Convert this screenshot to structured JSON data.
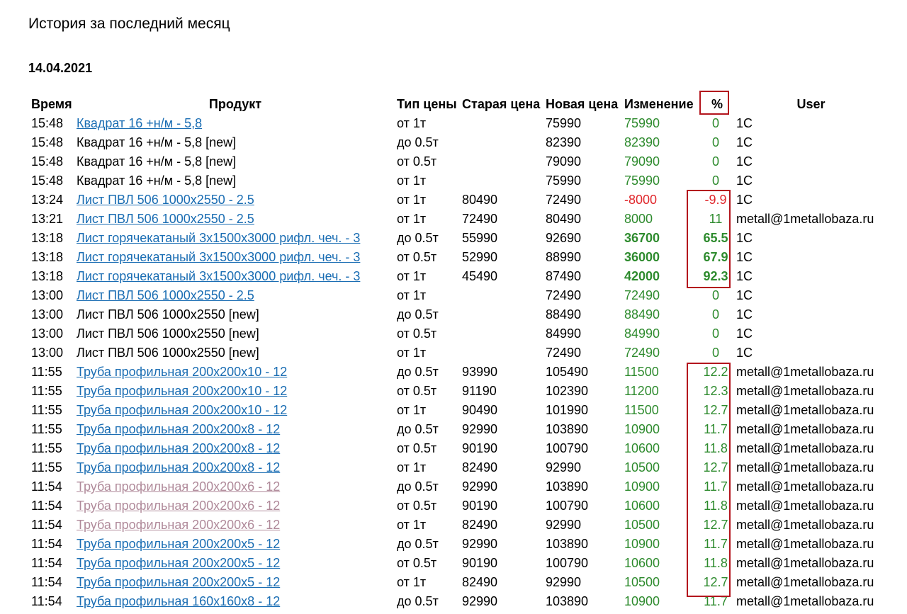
{
  "page": {
    "title": "История за последний месяц",
    "date": "14.04.2021"
  },
  "table": {
    "headers": {
      "time": "Время",
      "product": "Продукт",
      "price_type": "Тип цены",
      "old_price": "Старая цена",
      "new_price": "Новая цена",
      "change": "Изменение",
      "percent": "%",
      "user": "User"
    },
    "rows": [
      {
        "time": "15:48",
        "product": "Квадрат 16 +н/м - 5,8",
        "link": true,
        "visited": false,
        "price_type": "от 1т",
        "old_price": "",
        "new_price": "75990",
        "change": "75990",
        "change_color": "pos",
        "bold": false,
        "percent": "0",
        "pct_color": "pos",
        "user": "1С"
      },
      {
        "time": "15:48",
        "product": "Квадрат 16 +н/м - 5,8 [new]",
        "link": false,
        "visited": false,
        "price_type": "до 0.5т",
        "old_price": "",
        "new_price": "82390",
        "change": "82390",
        "change_color": "pos",
        "bold": false,
        "percent": "0",
        "pct_color": "pos",
        "user": "1С"
      },
      {
        "time": "15:48",
        "product": "Квадрат 16 +н/м - 5,8 [new]",
        "link": false,
        "visited": false,
        "price_type": "от 0.5т",
        "old_price": "",
        "new_price": "79090",
        "change": "79090",
        "change_color": "pos",
        "bold": false,
        "percent": "0",
        "pct_color": "pos",
        "user": "1С"
      },
      {
        "time": "15:48",
        "product": "Квадрат 16 +н/м - 5,8 [new]",
        "link": false,
        "visited": false,
        "price_type": "от 1т",
        "old_price": "",
        "new_price": "75990",
        "change": "75990",
        "change_color": "pos",
        "bold": false,
        "percent": "0",
        "pct_color": "pos",
        "user": "1С"
      },
      {
        "time": "13:24",
        "product": "Лист ПВЛ 506 1000x2550 - 2.5",
        "link": true,
        "visited": false,
        "price_type": "от 1т",
        "old_price": "80490",
        "new_price": "72490",
        "change": "-8000",
        "change_color": "neg",
        "bold": false,
        "percent": "-9.9",
        "pct_color": "neg",
        "user": "1С"
      },
      {
        "time": "13:21",
        "product": "Лист ПВЛ 506 1000x2550 - 2.5",
        "link": true,
        "visited": false,
        "price_type": "от 1т",
        "old_price": "72490",
        "new_price": "80490",
        "change": "8000",
        "change_color": "pos",
        "bold": false,
        "percent": "11",
        "pct_color": "pos",
        "user": "metall@1metallobaza.ru"
      },
      {
        "time": "13:18",
        "product": "Лист горячекатаный 3x1500x3000 рифл. чеч. - 3",
        "link": true,
        "visited": false,
        "price_type": "до 0.5т",
        "old_price": "55990",
        "new_price": "92690",
        "change": "36700",
        "change_color": "pos",
        "bold": true,
        "percent": "65.5",
        "pct_color": "pos",
        "user": "1С"
      },
      {
        "time": "13:18",
        "product": "Лист горячекатаный 3x1500x3000 рифл. чеч. - 3",
        "link": true,
        "visited": false,
        "price_type": "от 0.5т",
        "old_price": "52990",
        "new_price": "88990",
        "change": "36000",
        "change_color": "pos",
        "bold": true,
        "percent": "67.9",
        "pct_color": "pos",
        "user": "1С"
      },
      {
        "time": "13:18",
        "product": "Лист горячекатаный 3x1500x3000 рифл. чеч. - 3",
        "link": true,
        "visited": false,
        "price_type": "от 1т",
        "old_price": "45490",
        "new_price": "87490",
        "change": "42000",
        "change_color": "pos",
        "bold": true,
        "percent": "92.3",
        "pct_color": "pos",
        "user": "1С"
      },
      {
        "time": "13:00",
        "product": "Лист ПВЛ 506 1000x2550 - 2.5",
        "link": true,
        "visited": false,
        "price_type": "от 1т",
        "old_price": "",
        "new_price": "72490",
        "change": "72490",
        "change_color": "pos",
        "bold": false,
        "percent": "0",
        "pct_color": "pos",
        "user": "1С"
      },
      {
        "time": "13:00",
        "product": "Лист ПВЛ 506 1000x2550 [new]",
        "link": false,
        "visited": false,
        "price_type": "до 0.5т",
        "old_price": "",
        "new_price": "88490",
        "change": "88490",
        "change_color": "pos",
        "bold": false,
        "percent": "0",
        "pct_color": "pos",
        "user": "1С"
      },
      {
        "time": "13:00",
        "product": "Лист ПВЛ 506 1000x2550 [new]",
        "link": false,
        "visited": false,
        "price_type": "от 0.5т",
        "old_price": "",
        "new_price": "84990",
        "change": "84990",
        "change_color": "pos",
        "bold": false,
        "percent": "0",
        "pct_color": "pos",
        "user": "1С"
      },
      {
        "time": "13:00",
        "product": "Лист ПВЛ 506 1000x2550 [new]",
        "link": false,
        "visited": false,
        "price_type": "от 1т",
        "old_price": "",
        "new_price": "72490",
        "change": "72490",
        "change_color": "pos",
        "bold": false,
        "percent": "0",
        "pct_color": "pos",
        "user": "1С"
      },
      {
        "time": "11:55",
        "product": "Труба профильная 200x200x10 - 12",
        "link": true,
        "visited": false,
        "price_type": "до 0.5т",
        "old_price": "93990",
        "new_price": "105490",
        "change": "11500",
        "change_color": "pos",
        "bold": false,
        "percent": "12.2",
        "pct_color": "pos",
        "user": "metall@1metallobaza.ru"
      },
      {
        "time": "11:55",
        "product": "Труба профильная 200x200x10 - 12",
        "link": true,
        "visited": false,
        "price_type": "от 0.5т",
        "old_price": "91190",
        "new_price": "102390",
        "change": "11200",
        "change_color": "pos",
        "bold": false,
        "percent": "12.3",
        "pct_color": "pos",
        "user": "metall@1metallobaza.ru"
      },
      {
        "time": "11:55",
        "product": "Труба профильная 200x200x10 - 12",
        "link": true,
        "visited": false,
        "price_type": "от 1т",
        "old_price": "90490",
        "new_price": "101990",
        "change": "11500",
        "change_color": "pos",
        "bold": false,
        "percent": "12.7",
        "pct_color": "pos",
        "user": "metall@1metallobaza.ru"
      },
      {
        "time": "11:55",
        "product": "Труба профильная 200x200x8 - 12",
        "link": true,
        "visited": false,
        "price_type": "до 0.5т",
        "old_price": "92990",
        "new_price": "103890",
        "change": "10900",
        "change_color": "pos",
        "bold": false,
        "percent": "11.7",
        "pct_color": "pos",
        "user": "metall@1metallobaza.ru"
      },
      {
        "time": "11:55",
        "product": "Труба профильная 200x200x8 - 12",
        "link": true,
        "visited": false,
        "price_type": "от 0.5т",
        "old_price": "90190",
        "new_price": "100790",
        "change": "10600",
        "change_color": "pos",
        "bold": false,
        "percent": "11.8",
        "pct_color": "pos",
        "user": "metall@1metallobaza.ru"
      },
      {
        "time": "11:55",
        "product": "Труба профильная 200x200x8 - 12",
        "link": true,
        "visited": false,
        "price_type": "от 1т",
        "old_price": "82490",
        "new_price": "92990",
        "change": "10500",
        "change_color": "pos",
        "bold": false,
        "percent": "12.7",
        "pct_color": "pos",
        "user": "metall@1metallobaza.ru"
      },
      {
        "time": "11:54",
        "product": "Труба профильная 200x200x6 - 12",
        "link": true,
        "visited": true,
        "price_type": "до 0.5т",
        "old_price": "92990",
        "new_price": "103890",
        "change": "10900",
        "change_color": "pos",
        "bold": false,
        "percent": "11.7",
        "pct_color": "pos",
        "user": "metall@1metallobaza.ru"
      },
      {
        "time": "11:54",
        "product": "Труба профильная 200x200x6 - 12",
        "link": true,
        "visited": true,
        "price_type": "от 0.5т",
        "old_price": "90190",
        "new_price": "100790",
        "change": "10600",
        "change_color": "pos",
        "bold": false,
        "percent": "11.8",
        "pct_color": "pos",
        "user": "metall@1metallobaza.ru"
      },
      {
        "time": "11:54",
        "product": "Труба профильная 200x200x6 - 12",
        "link": true,
        "visited": true,
        "price_type": "от 1т",
        "old_price": "82490",
        "new_price": "92990",
        "change": "10500",
        "change_color": "pos",
        "bold": false,
        "percent": "12.7",
        "pct_color": "pos",
        "user": "metall@1metallobaza.ru"
      },
      {
        "time": "11:54",
        "product": "Труба профильная 200x200x5 - 12",
        "link": true,
        "visited": false,
        "price_type": "до 0.5т",
        "old_price": "92990",
        "new_price": "103890",
        "change": "10900",
        "change_color": "pos",
        "bold": false,
        "percent": "11.7",
        "pct_color": "pos",
        "user": "metall@1metallobaza.ru"
      },
      {
        "time": "11:54",
        "product": "Труба профильная 200x200x5 - 12",
        "link": true,
        "visited": false,
        "price_type": "от 0.5т",
        "old_price": "90190",
        "new_price": "100790",
        "change": "10600",
        "change_color": "pos",
        "bold": false,
        "percent": "11.8",
        "pct_color": "pos",
        "user": "metall@1metallobaza.ru"
      },
      {
        "time": "11:54",
        "product": "Труба профильная 200x200x5 - 12",
        "link": true,
        "visited": false,
        "price_type": "от 1т",
        "old_price": "82490",
        "new_price": "92990",
        "change": "10500",
        "change_color": "pos",
        "bold": false,
        "percent": "12.7",
        "pct_color": "pos",
        "user": "metall@1metallobaza.ru"
      },
      {
        "time": "11:54",
        "product": "Труба профильная 160x160x8 - 12",
        "link": true,
        "visited": false,
        "price_type": "до 0.5т",
        "old_price": "92990",
        "new_price": "103890",
        "change": "10900",
        "change_color": "pos",
        "bold": false,
        "percent": "11.7",
        "pct_color": "pos",
        "user": "metall@1metallobaza.ru"
      }
    ]
  },
  "colors": {
    "link": "#1a6db3",
    "link_visited": "#b08a9a",
    "positive": "#2e8b2e",
    "negative": "#e0262b",
    "highlight_box": "#b3151d"
  }
}
